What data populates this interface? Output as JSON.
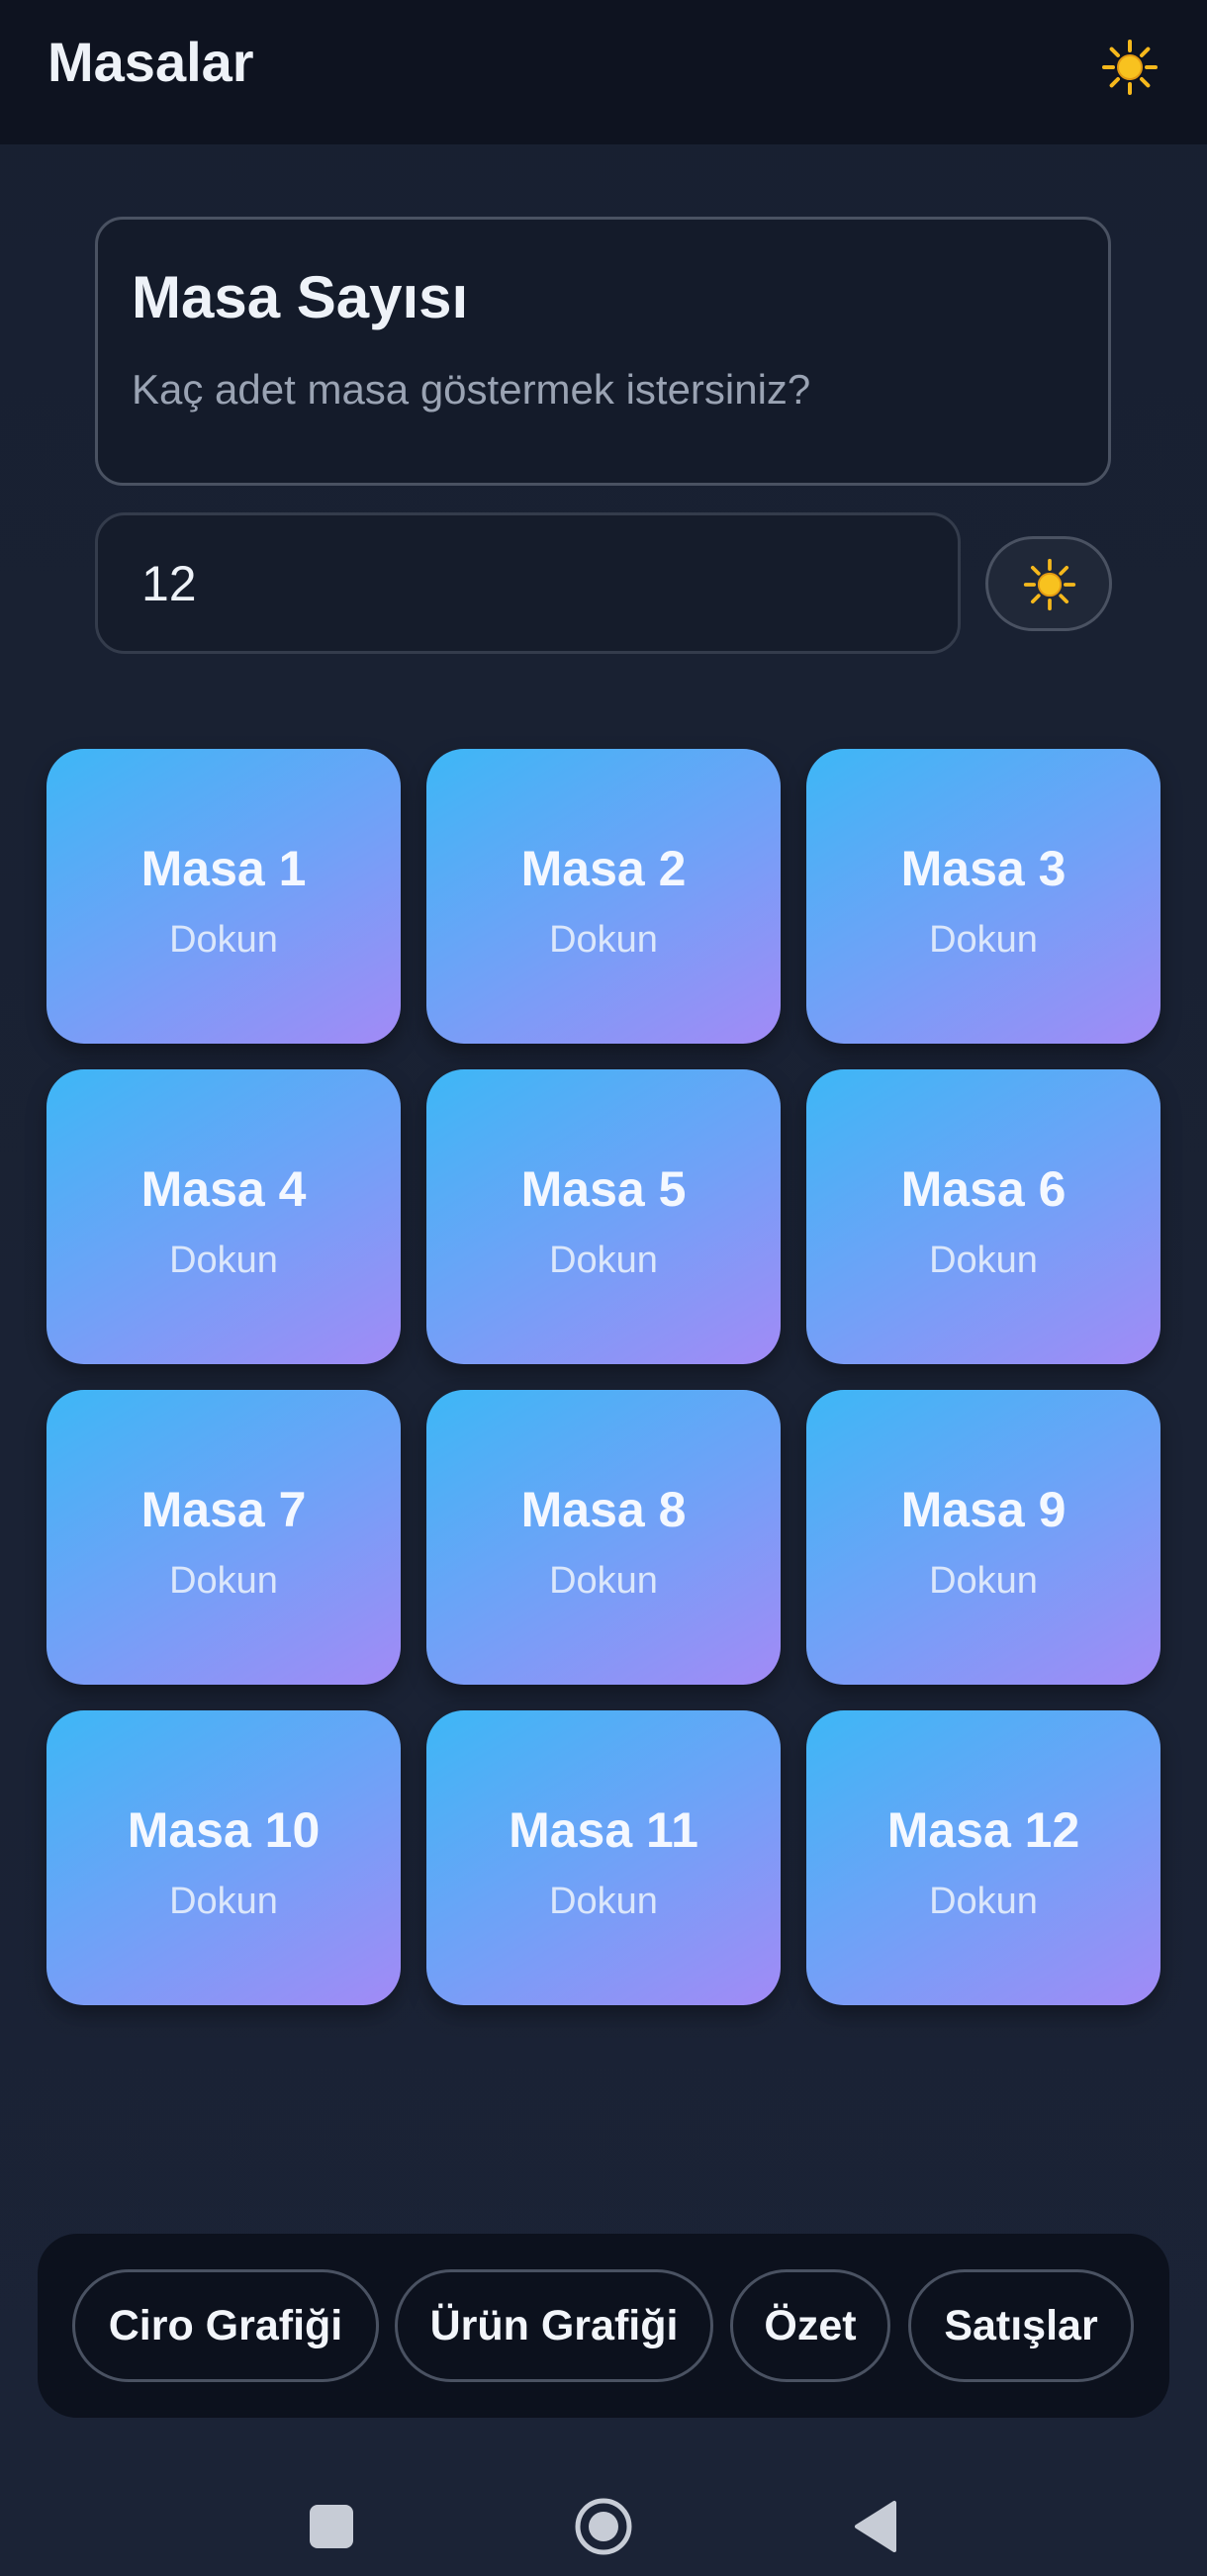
{
  "app_bar": {
    "title": "Masalar",
    "action_icon": "sun-icon"
  },
  "count_card": {
    "title": "Masa Sayısı",
    "subtitle": "Kaç adet masa göstermek istersiniz?"
  },
  "count_input": {
    "value": "12",
    "action_icon": "sun-icon"
  },
  "tables": [
    {
      "name": "Masa 1",
      "hint": "Dokun"
    },
    {
      "name": "Masa 2",
      "hint": "Dokun"
    },
    {
      "name": "Masa 3",
      "hint": "Dokun"
    },
    {
      "name": "Masa 4",
      "hint": "Dokun"
    },
    {
      "name": "Masa 5",
      "hint": "Dokun"
    },
    {
      "name": "Masa 6",
      "hint": "Dokun"
    },
    {
      "name": "Masa 7",
      "hint": "Dokun"
    },
    {
      "name": "Masa 8",
      "hint": "Dokun"
    },
    {
      "name": "Masa 9",
      "hint": "Dokun"
    },
    {
      "name": "Masa 10",
      "hint": "Dokun"
    },
    {
      "name": "Masa 11",
      "hint": "Dokun"
    },
    {
      "name": "Masa 12",
      "hint": "Dokun"
    }
  ],
  "bottom_nav": {
    "revenue_chart": "Ciro Grafiği",
    "product_chart": "Ürün Grafiği",
    "summary": "Özet",
    "sales": "Satışlar"
  },
  "system_nav": {
    "recents_icon": "square-icon",
    "home_icon": "circle-home-icon",
    "back_icon": "triangle-back-icon"
  },
  "colors": {
    "background": "#1a2234",
    "top_bar": "#0e1320",
    "tile_gradient_start": "#3db7f6",
    "tile_gradient_end": "#a28af6",
    "bottom_bar": "#0c111d",
    "sun": "#f5b81c"
  }
}
